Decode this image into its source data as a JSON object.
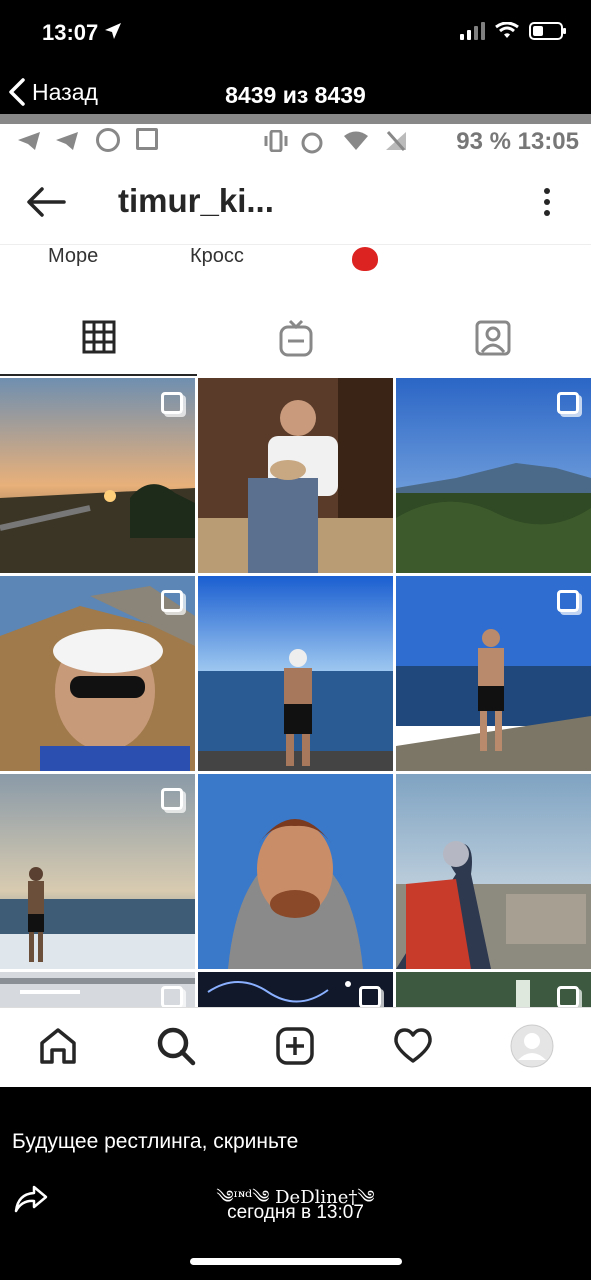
{
  "ios_status": {
    "time": "13:07"
  },
  "viewer": {
    "back_label": "Назад",
    "counter": "8439 из 8439"
  },
  "android_status": {
    "battery_text": "93 %  13:05"
  },
  "profile": {
    "username": "timur_ki..."
  },
  "highlights": [
    "Море",
    "Кросс"
  ],
  "icons": {
    "location": "location-arrow-icon",
    "wifi": "wifi-icon",
    "battery": "battery-icon",
    "back": "chevron-left-icon",
    "ig_back": "arrow-left-icon",
    "more": "more-vertical-icon",
    "grid": "grid-icon",
    "igtv": "igtv-icon",
    "tagged": "tagged-user-icon",
    "home": "home-icon",
    "search": "search-icon",
    "add": "add-square-icon",
    "heart": "heart-icon",
    "profile": "profile-avatar-icon",
    "share": "share-icon"
  },
  "colors": {
    "ig_text": "#262626",
    "viewer_bg": "#000000",
    "screen_bg": "#ffffff"
  },
  "caption": {
    "text": "Будущее рестлинга, скриньте",
    "author": "༄ᶦᶰᵈ༄ DeDline†༄",
    "date": "сегодня в 13:07"
  }
}
